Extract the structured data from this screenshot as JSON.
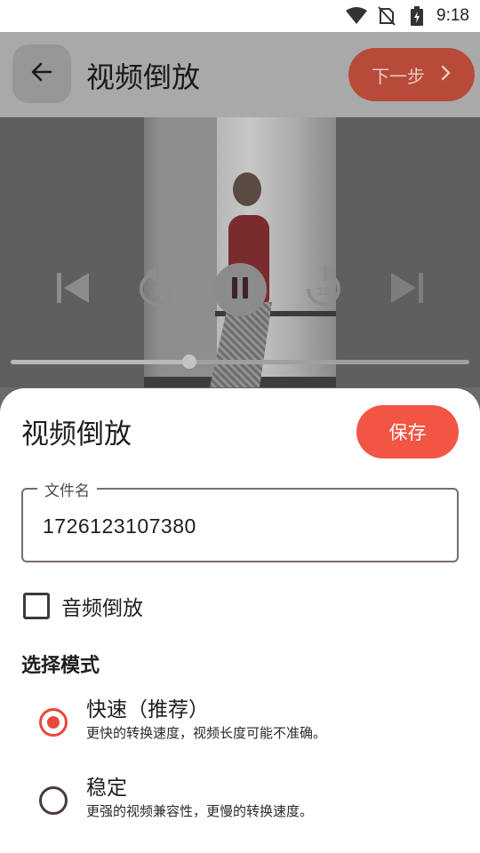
{
  "status_bar": {
    "time": "9:18",
    "icons": [
      "wifi-icon",
      "no-sim-icon",
      "battery-charging-icon"
    ]
  },
  "top_bar": {
    "back_icon": "arrow-left-icon",
    "title": "视频倒放",
    "next_label": "下一步",
    "next_icon": "chevron-right-icon"
  },
  "player": {
    "controls": [
      "skip-previous-icon",
      "rewind-5-icon",
      "pause-icon",
      "forward-15-icon",
      "skip-next-icon"
    ],
    "rewind_seconds": "5",
    "forward_seconds": "15",
    "progress": 0.39
  },
  "sheet": {
    "title": "视频倒放",
    "save_label": "保存",
    "filename_label": "文件名",
    "filename_value": "1726123107380",
    "audio_reverse_label": "音频倒放",
    "audio_reverse_checked": false,
    "mode_title": "选择模式",
    "modes": [
      {
        "title": "快速（推荐）",
        "description": "更快的转换速度，视频长度可能不准确。",
        "selected": true
      },
      {
        "title": "稳定",
        "description": "更强的视频兼容性，更慢的转换速度。",
        "selected": false
      }
    ]
  },
  "colors": {
    "accent": "#f25544",
    "radio_selected": "#e8483a",
    "dim_next_button": "#b84a3a"
  }
}
